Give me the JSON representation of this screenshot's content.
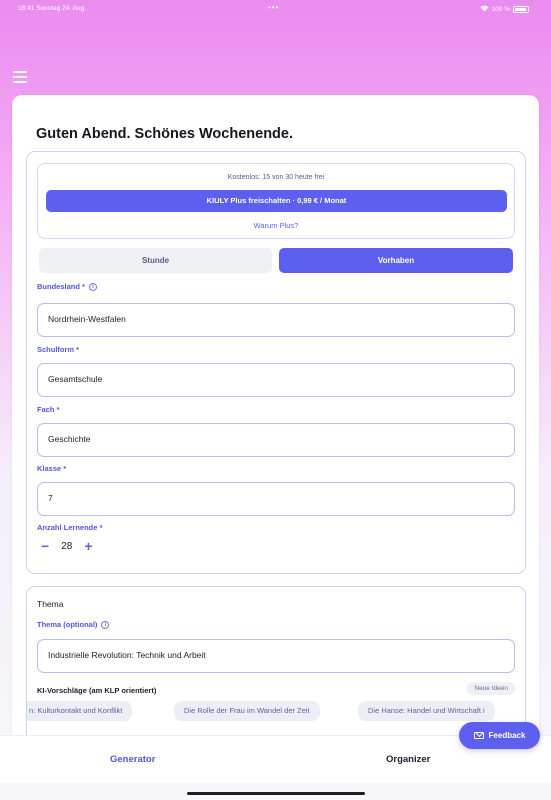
{
  "status_bar": {
    "time_date": "18:41  Sonntag 24. Aug.",
    "dots": "•••",
    "battery": "100 %"
  },
  "greeting": "Guten Abend. Schönes Wochenende.",
  "plus": {
    "quota": "Kostenlos: 15 von 30 heute frei",
    "button": "KIULY Plus freischalten · 0,99 € / Monat",
    "why": "Warum Plus?"
  },
  "mode_tabs": {
    "stunde": "Stunde",
    "vorhaben": "Vorhaben",
    "selected": "Vorhaben"
  },
  "form": {
    "bundesland": {
      "label": "Bundesland *",
      "value": "Nordrhein-Westfalen"
    },
    "schulform": {
      "label": "Schulform *",
      "value": "Gesamtschule"
    },
    "fach": {
      "label": "Fach *",
      "value": "Geschichte"
    },
    "klasse": {
      "label": "Klasse *",
      "value": "7"
    },
    "anzahl": {
      "label": "Anzahl Lernende *",
      "minus": "−",
      "value": "28",
      "plus": "+"
    }
  },
  "thema": {
    "section_title": "Thema",
    "label": "Thema (optional)",
    "value": "Industrielle Revolution: Technik und Arbeit",
    "ki_title": "KI-Vorschläge (am KLP orientiert)",
    "new_ideas": "Neue Ideen",
    "chips": [
      "n: Kulturkontakt und Konflikt",
      "Die Rolle der Frau im Wandel der Zeit",
      "Die Hanse: Handel und Wirtschaft i"
    ]
  },
  "tabs": {
    "generator": "Generator",
    "organizer": "Organizer"
  },
  "feedback": "Feedback",
  "colors": {
    "accent": "#5d5fef",
    "label": "#5256d8",
    "gradient_top": "#e98cf0"
  }
}
